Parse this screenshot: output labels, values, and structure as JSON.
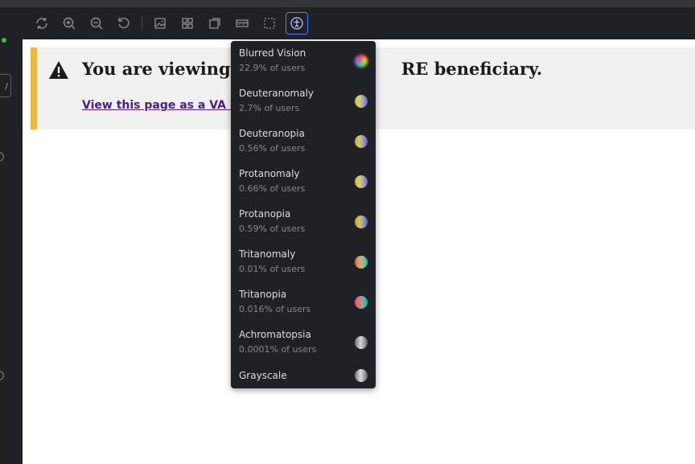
{
  "toolbar": {
    "buttons": [
      {
        "icon": "sync-icon"
      },
      {
        "icon": "zoom-in-icon"
      },
      {
        "icon": "zoom-out-icon"
      },
      {
        "icon": "reset-zoom-icon"
      },
      {
        "icon": "background-icon"
      },
      {
        "icon": "grid-icon"
      },
      {
        "icon": "outline-icon"
      },
      {
        "icon": "measure-icon"
      },
      {
        "icon": "viewport-icon"
      },
      {
        "icon": "accessibility-icon",
        "active": true
      }
    ]
  },
  "rail": {
    "box_text": "/"
  },
  "alert": {
    "title": "You are viewing th",
    "title_tail": "RE beneficiary.",
    "link": "View this page as a VA bene"
  },
  "vision_menu": {
    "items": [
      {
        "label": "Blurred Vision",
        "sub": "22.9% of users",
        "swatch": "blur"
      },
      {
        "label": "Deuteranomaly",
        "sub": "2.7% of users",
        "swatch": "deuteranomaly"
      },
      {
        "label": "Deuteranopia",
        "sub": "0.56% of users",
        "swatch": "deuteranopia"
      },
      {
        "label": "Protanomaly",
        "sub": "0.66% of users",
        "swatch": "protanomaly"
      },
      {
        "label": "Protanopia",
        "sub": "0.59% of users",
        "swatch": "protanopia"
      },
      {
        "label": "Tritanomaly",
        "sub": "0.01% of users",
        "swatch": "tritanomaly"
      },
      {
        "label": "Tritanopia",
        "sub": "0.016% of users",
        "swatch": "tritanopia"
      },
      {
        "label": "Achromatopsia",
        "sub": "0.0001% of users",
        "swatch": "achromatopsia"
      },
      {
        "label": "Grayscale",
        "sub": "",
        "swatch": "grayscale"
      }
    ]
  },
  "colors": {
    "alert_accent": "#f3b730",
    "link": "#4a1d8c",
    "active_outline": "#4a7dff"
  }
}
